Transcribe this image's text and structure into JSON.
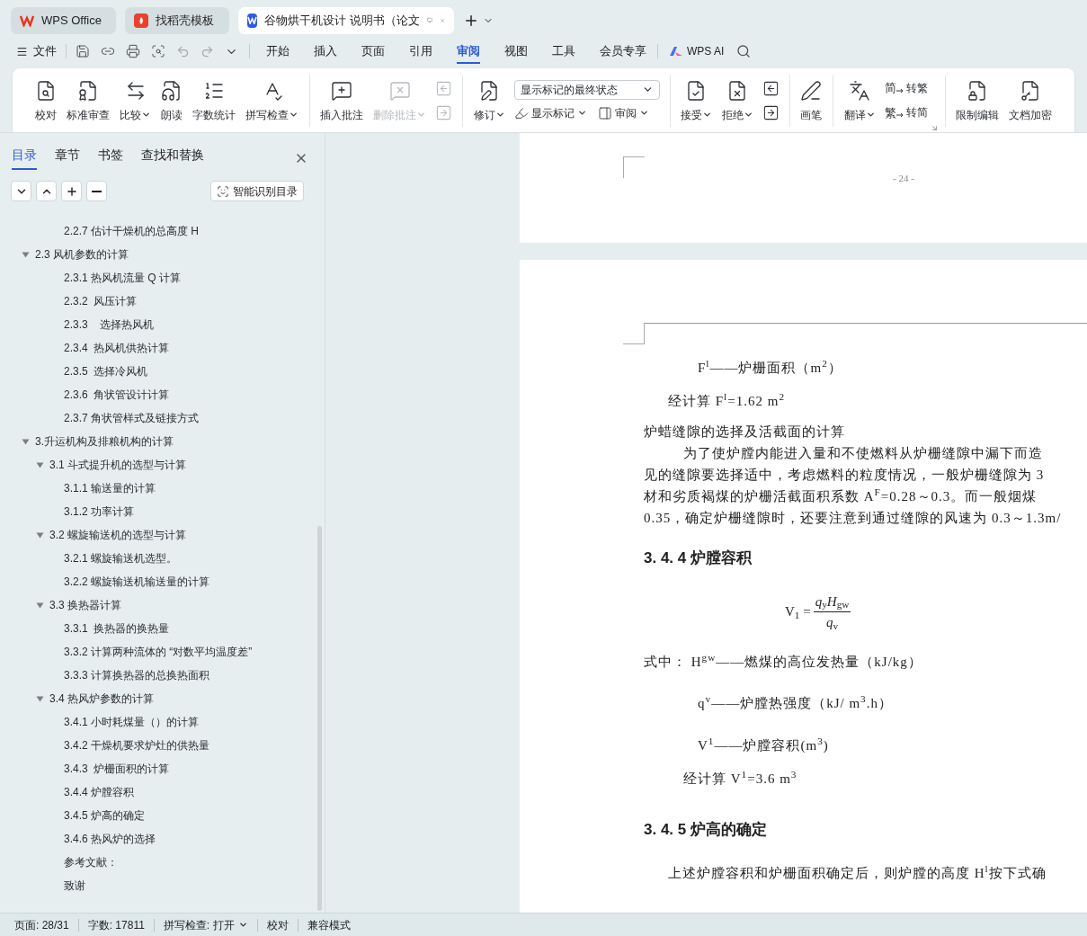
{
  "window_tabs": [
    {
      "kind": "wps",
      "label": "WPS Office",
      "selected": false
    },
    {
      "kind": "docer",
      "label": "找稻壳模板",
      "selected": false
    },
    {
      "kind": "doc",
      "label": "谷物烘干机设计 说明书（论文",
      "selected": true
    }
  ],
  "menu": {
    "file": "文件",
    "tabs": [
      {
        "label": "开始",
        "selected": false
      },
      {
        "label": "插入",
        "selected": false
      },
      {
        "label": "页面",
        "selected": false
      },
      {
        "label": "引用",
        "selected": false
      },
      {
        "label": "审阅",
        "selected": true
      },
      {
        "label": "视图",
        "selected": false
      },
      {
        "label": "工具",
        "selected": false
      },
      {
        "label": "会员专享",
        "selected": false
      }
    ],
    "ai": "WPS AI"
  },
  "ribbon": [
    [
      {
        "kind": "large",
        "label": "校对",
        "menu": false,
        "disabled": false
      },
      {
        "kind": "large",
        "label": "标准审查",
        "menu": false,
        "disabled": false
      },
      {
        "kind": "large",
        "label": "比较",
        "menu": true,
        "disabled": false
      },
      {
        "kind": "large",
        "label": "朗读",
        "menu": false,
        "disabled": false
      },
      {
        "kind": "large",
        "label": "字数统计",
        "menu": false,
        "disabled": false
      },
      {
        "kind": "large",
        "label": "拼写检查",
        "menu": true,
        "disabled": false
      }
    ],
    [
      {
        "kind": "large",
        "label": "插入批注",
        "menu": false,
        "disabled": false
      },
      {
        "kind": "large",
        "label": "删除批注",
        "menu": true,
        "disabled": true
      },
      {
        "kind": "iconpair",
        "disabled": true
      }
    ],
    [
      {
        "kind": "large",
        "label": "修订",
        "menu": true,
        "disabled": false
      },
      {
        "kind": "select",
        "value": "显示标记的最终状态",
        "row": [
          {
            "label": "显示标记",
            "menu": true
          },
          {
            "label": "审阅",
            "menu": true
          }
        ]
      }
    ],
    [
      {
        "kind": "large",
        "label": "接受",
        "menu": true,
        "disabled": false
      },
      {
        "kind": "large",
        "label": "拒绝",
        "menu": true,
        "disabled": false
      },
      {
        "kind": "iconpair",
        "disabled": false
      }
    ],
    [
      {
        "kind": "large",
        "label": "画笔",
        "menu": false,
        "disabled": false
      }
    ],
    [
      {
        "kind": "large",
        "label": "翻译",
        "menu": true,
        "disabled": false
      },
      {
        "kind": "convert",
        "items": [
          {
            "glyph": "简",
            "label": "转繁"
          },
          {
            "glyph": "繁",
            "label": "转简"
          }
        ]
      }
    ],
    [
      {
        "kind": "large",
        "label": "限制编辑",
        "menu": false,
        "disabled": false
      },
      {
        "kind": "large",
        "label": "文档加密",
        "menu": false,
        "disabled": false
      }
    ]
  ],
  "sidebar": {
    "tabs": [
      {
        "label": "目录",
        "selected": true
      },
      {
        "label": "章节",
        "selected": false
      },
      {
        "label": "书签",
        "selected": false
      },
      {
        "label": "查找和替换",
        "selected": false
      }
    ],
    "smart_button": "智能识别目录",
    "toc": [
      {
        "label": "2.2.7 估计干燥机的总高度 H"
      },
      {
        "label": "2.3 风机参数的计算",
        "expanded": true,
        "children": [
          {
            "label": "2.3.1 热风机流量 Q 计算"
          },
          {
            "label": "2.3.2  风压计算"
          },
          {
            "label": "2.3.3    选择热风机"
          },
          {
            "label": "2.3.4  热风机供热计算"
          },
          {
            "label": "2.3.5  选择冷风机"
          },
          {
            "label": "2.3.6  角状管设计计算"
          },
          {
            "label": "2.3.7 角状管样式及链接方式"
          }
        ]
      },
      {
        "label": "3.升运机构及排粮机构的计算",
        "expanded": true,
        "children": [
          {
            "label": "3.1 斗式提升机的选型与计算",
            "expanded": true,
            "children": [
              {
                "label": "3.1.1 输送量的计算"
              },
              {
                "label": "3.1.2 功率计算"
              }
            ]
          },
          {
            "label": "3.2 螺旋输送机的选型与计算",
            "expanded": true,
            "children": [
              {
                "label": "3.2.1 螺旋输送机选型。"
              },
              {
                "label": "3.2.2 螺旋输送机输送量的计算"
              }
            ]
          },
          {
            "label": "3.3 换热器计算",
            "expanded": true,
            "children": [
              {
                "label": "3.3.1  换热器的换热量"
              },
              {
                "label": "3.3.2 计算两种流体的 “对数平均温度差”"
              },
              {
                "label": "3.3.3 计算换热器的总换热面积"
              }
            ]
          },
          {
            "label": "3.4 热风炉参数的计算",
            "expanded": true,
            "children": [
              {
                "label": "3.4.1 小时耗煤量（）的计算"
              },
              {
                "label": "3.4.2 干燥机要求炉灶的供热量"
              },
              {
                "label": "3.4.3  炉栅面积的计算"
              },
              {
                "label": "3.4.4 炉膛容积"
              },
              {
                "label": "3.4.5 炉高的确定"
              },
              {
                "label": "3.4.6 热风炉的选择"
              }
            ]
          }
        ]
      },
      {
        "label": "参考文献："
      },
      {
        "label": "致谢"
      }
    ]
  },
  "document": {
    "page_number": "- 24 -",
    "blocks": [
      {
        "kind": "def",
        "text": "F$^{l}$——炉栅面积（m$^{2}$）"
      },
      {
        "kind": "result",
        "text": "经计算  F$^{l}$=1.62 m$^{2}$"
      },
      {
        "kind": "plain",
        "text": "炉蜡缝隙的选择及活截面的计算"
      },
      {
        "kind": "para-first",
        "text": "为了使炉膛内能进入量和不使燃料从炉栅缝隙中漏下而造"
      },
      {
        "kind": "para",
        "text": "见的缝隙要选择适中，考虑燃料的粒度情况，一般炉栅缝隙为 3"
      },
      {
        "kind": "para",
        "text": "材和劣质褐煤的炉栅活截面积系数 A$^{F}$=0.28～0.3。而一般烟煤"
      },
      {
        "kind": "para",
        "text": "0.35，确定炉栅缝隙时，还要注意到通过缝隙的风速为 0.3～1.3m/"
      },
      {
        "kind": "heading",
        "text": "3. 4. 4 炉膛容积"
      },
      {
        "kind": "formula",
        "lhs": "V$_{1}$ =",
        "numerator": "*q*$_{y}$*H*$_{gw}$",
        "denominator": "*q*$_{v}$"
      },
      {
        "kind": "where",
        "text": "式中：  H$^{gw}$——燃煤的高位发热量（kJ/kg）"
      },
      {
        "kind": "def",
        "text": "q$^{v}$——炉膛热强度（kJ/ m$^{3}$.h）"
      },
      {
        "kind": "def",
        "text": "V$^{1}$——炉膛容积(m$^{3}$)"
      },
      {
        "kind": "result2",
        "text": "经计算  V$^{1}$=3.6 m$^{3}$"
      },
      {
        "kind": "heading",
        "text": "3. 4. 5 炉高的确定"
      },
      {
        "kind": "result",
        "text": "上述炉膛容积和炉栅面积确定后，则炉膛的高度 H$^{l}$按下式确"
      }
    ]
  },
  "status_bar": [
    {
      "label": "页面: 28/31",
      "menu": false
    },
    {
      "label": "字数: 17811",
      "menu": false
    },
    {
      "label": "拼写检查: 打开",
      "menu": true
    },
    {
      "label": "校对",
      "menu": false
    },
    {
      "label": "兼容模式",
      "menu": false
    }
  ]
}
